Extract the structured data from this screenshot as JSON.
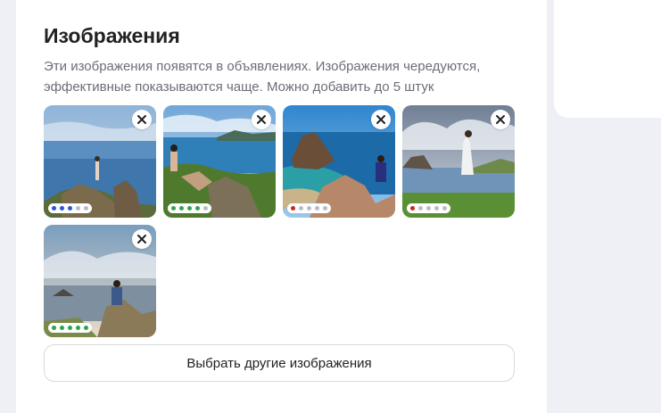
{
  "section": {
    "title": "Изображения",
    "description": "Эти изображения появятся в объявлениях. Изображения чередуются, эффективные показываются чаще. Можно добавить до 5 штук"
  },
  "images": [
    {
      "alt": "image-1",
      "remove_icon": "close-icon",
      "rating_dots": [
        "#2b54d6",
        "#2b54d6",
        "#2b54d6",
        "#b8bcc5",
        "#b8bcc5"
      ]
    },
    {
      "alt": "image-2",
      "remove_icon": "close-icon",
      "rating_dots": [
        "#2ea44f",
        "#2ea44f",
        "#2ea44f",
        "#2ea44f",
        "#b8bcc5"
      ]
    },
    {
      "alt": "image-3",
      "remove_icon": "close-icon",
      "rating_dots": [
        "#d0251b",
        "#b8bcc5",
        "#b8bcc5",
        "#b8bcc5",
        "#b8bcc5"
      ]
    },
    {
      "alt": "image-4",
      "remove_icon": "close-icon",
      "rating_dots": [
        "#d0251b",
        "#b8bcc5",
        "#b8bcc5",
        "#b8bcc5",
        "#b8bcc5"
      ]
    },
    {
      "alt": "image-5",
      "remove_icon": "close-icon",
      "rating_dots": [
        "#2ea44f",
        "#2ea44f",
        "#2ea44f",
        "#2ea44f",
        "#2ea44f"
      ]
    }
  ],
  "actions": {
    "choose_other_label": "Выбрать другие изображения"
  },
  "colors": {
    "background": "#eef0f5",
    "card": "#ffffff",
    "title": "#222222",
    "description": "#6b6e77"
  }
}
